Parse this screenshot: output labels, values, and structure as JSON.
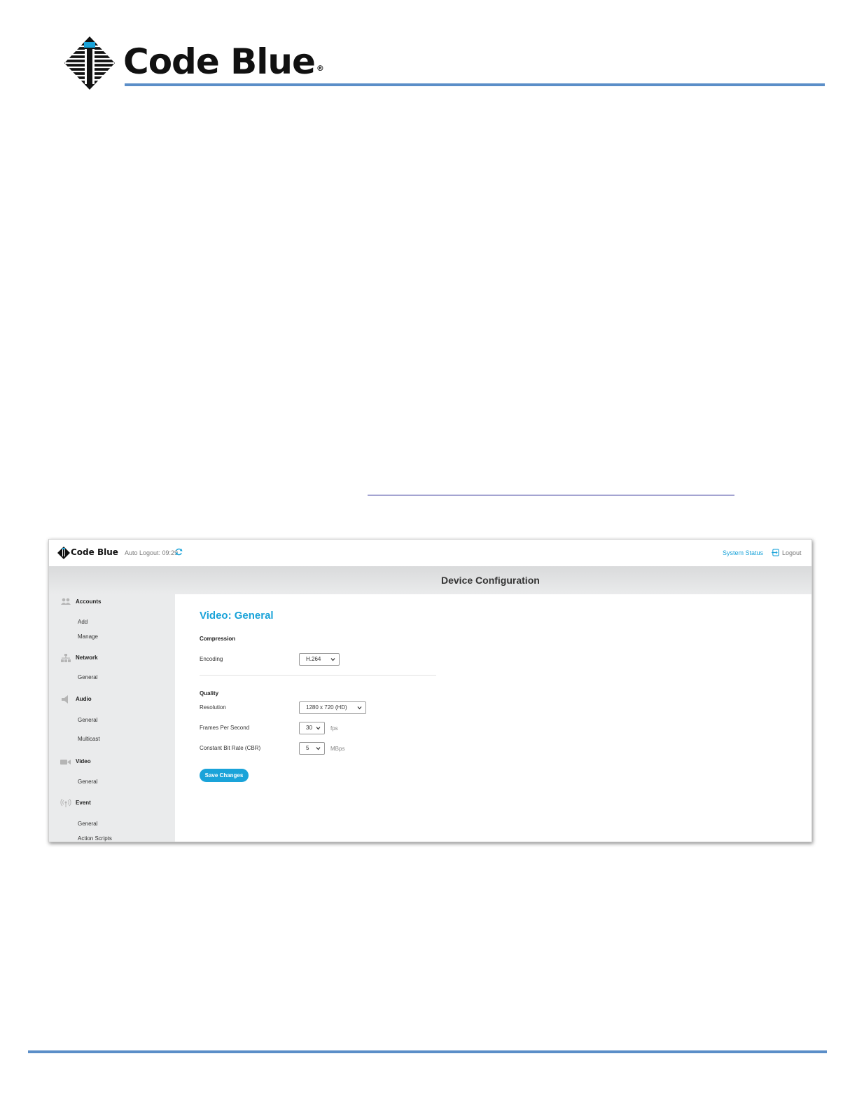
{
  "document": {
    "brand": "Code Blue",
    "registered_mark": "®"
  },
  "app": {
    "brand": "Code Blue",
    "auto_logout_label": "Auto Logout: 09:29",
    "system_status_link": "System Status",
    "logout_label": "Logout",
    "page_title": "Device Configuration",
    "accent_color": "#1aa3d9"
  },
  "sidebar": {
    "sections": [
      {
        "label": "Accounts",
        "icon": "users-icon",
        "items": [
          "Add",
          "Manage"
        ]
      },
      {
        "label": "Network",
        "icon": "network-icon",
        "items": [
          "General"
        ]
      },
      {
        "label": "Audio",
        "icon": "speaker-icon",
        "items": [
          "General",
          "Multicast"
        ]
      },
      {
        "label": "Video",
        "icon": "video-camera-icon",
        "items": [
          "General"
        ]
      },
      {
        "label": "Event",
        "icon": "broadcast-icon",
        "items": [
          "General",
          "Action Scripts"
        ]
      }
    ]
  },
  "content": {
    "title": "Video: General",
    "compression": {
      "heading": "Compression",
      "encoding_label": "Encoding",
      "encoding_value": "H.264"
    },
    "quality": {
      "heading": "Quality",
      "resolution_label": "Resolution",
      "resolution_value": "1280 x 720 (HD)",
      "fps_label": "Frames Per Second",
      "fps_value": "30",
      "fps_unit": "fps",
      "cbr_label": "Constant Bit Rate (CBR)",
      "cbr_value": "5",
      "cbr_unit": "MBps"
    },
    "save_button": "Save Changes"
  }
}
